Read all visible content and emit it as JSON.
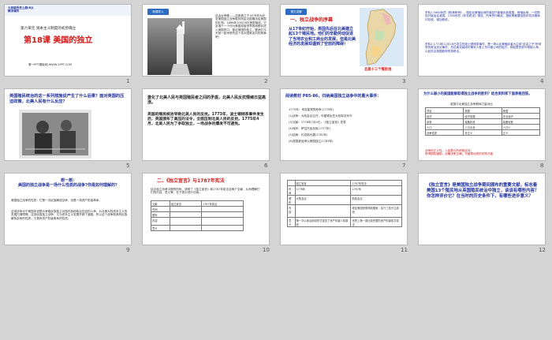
{
  "colors": {
    "accent_red": "#d21a1a",
    "title_blue": "#1f2f9c",
    "band_blue": "#2e6cc2"
  },
  "slides": [
    {
      "num": "1",
      "header": "九年级历史上册(RJ)\n教学课件",
      "unit": "第六单元 资本主义制度的初步确立",
      "title": "第18课  美国的独立",
      "footer": "第一PPT模板网-WWW.1PPT.COM"
    },
    {
      "num": "2",
      "tag": "新课导入",
      "text": "自由女神像——这座矗立于1876年为纪念美国独立战争胜利而由法国赠送给美国的礼物。1886年10月28日美国落成，它坐落于一个作为美国迎接世界各地移民进入美国的口，象征美国的独立，要我们今天就一起来研究这个伟大国家走向的故事吧！"
    },
    {
      "num": "3",
      "tag": "课文讲解",
      "heading": "一、独立战争的序幕",
      "text": "从17世纪开始，英国先后在北美建立起13个殖民地。他们的辛勤劳动促进了当地农业和工商业的发展，但是北美经济的发展却遇到了空前的障碍！",
      "map_caption": "北美十三个殖民地"
    },
    {
      "num": "4",
      "text1": "史料1  1660年的《航海条例》，规定北美殖民地的商品只能输出到英国，而殖民地，一切物品只能运往英国。1765年的《印花税法》规定，所有的印刷品，报纸等都要加贴印花并缴纳印花税，增加税收。",
      "text2": "史料2  1773年12月16日发生的波士顿倾茶事件，是一场以北美殖民者为主体\"自由之子\"所领导的政治抗议事件，抗议者化装成印第安人登上东印度公司的船只，将船里的茶叶倾倒入海，以此抗议英国政府的茶税法。"
    },
    {
      "num": "5",
      "text": "英国殖民统治的这一系列措施说产生了什么后果？面对英国的压迫政策，北美人民有什么反应？"
    },
    {
      "num": "6",
      "text1": "激化了北美人民与英国殖民者之间的矛盾，北美人民反抗情绪日益高涨。",
      "text2": "英国的殖民统治导致北美人民的反抗。1773年，波士顿倾茶事件发生后，英国颁布了高压的法令，全面压制北美人民的反抗，1775年4月，北美人民为了争取独立，一场战争的爆发不可避免。"
    },
    {
      "num": "7",
      "heading": "阅读教材 P85-86，归纳美国独立战争中的重大事件：",
      "items": [
        "1775年：来克星顿的枪声(1775年)",
        "(2)战争：大陆会议召开，华盛顿出任大陆军总司令",
        "(3)文献：1776年7月4日，《独立宣言》发表",
        "(4)转折：萨拉托加战役(1777年)",
        "(5)结局：约克镇大捷(1781年)",
        "(6)英国被迫承认美国独立(1783年)"
      ]
    },
    {
      "num": "8",
      "heading": "为什么弱小的美国能够取得独立战争的胜利？结合资料和下面表格回答。",
      "table_title": "英国与北美独立战争期间力量对比",
      "cols": [
        "项目",
        "英国",
        "美国"
      ],
      "rows": [
        [
          "经济",
          "经济发展",
          "农业经济"
        ],
        [
          "军事",
          "装备精良",
          "装备较差"
        ],
        [
          "人口",
          "人口众多",
          "人口少"
        ],
        [
          "战争性质",
          "非正义",
          "正义"
        ]
      ],
      "conclusion": "战争的正义性；人民群众的积极支持；\n获得国际援助，战略决策正确；华盛顿优秀的领导才能"
    },
    {
      "num": "9",
      "heading": "想一想：\n美国的独立战争是一场什么性质的战争?你是如何理解的？",
      "text1": "美国独立战争的性质：它是一次民族解放战争，也是一场资产阶级革命。",
      "text2": "这场战争对于美国来说是为争取民族独立对国内各种政治压迫的斗争，为北美大陆资本主义的发展扫清障碍。这场民族独立战争，又为资本主义发展开辟了道路。所以这个战争既具有民族解放战争的性质，又具有资产阶级革命的性质。"
    },
    {
      "num": "10",
      "heading": "二、《独立宣言》与1787年宪法",
      "intro": "结合独立战争中期的阶段，请带了《独立宣言》和1787年宪法这两个文献，从而理解它们的内容、意义等，在下表中进行归纳。",
      "cols": [
        "文献",
        "独立宣言",
        "1787年宪法"
      ],
      "rows": [
        "时间",
        "颁布",
        "内容",
        "意义"
      ]
    },
    {
      "num": "11",
      "cols": [
        "",
        "独立宣言",
        "1787年宪法"
      ],
      "rows": [
        [
          "时间",
          "1776年",
          "1787年"
        ],
        [
          "颁布",
          "大陆会议",
          "制宪会议"
        ],
        [
          "内容",
          "",
          "规定美国是联邦制国家，实行三权分立原则"
        ],
        [
          "意义",
          "第一次以政治纲领形式宣告了资产阶级人权原则",
          "世界上第一部比较完整的资产阶级成文宪法"
        ]
      ]
    },
    {
      "num": "12",
      "text": "《独立宣言》是美国独立战争期间颁布的重要文献，标志着美国13个殖民地从英国殖民统治中独立，谈谈有哪些内容？你怎样评价它？在当时的历史条件下，有哪些进步意义？"
    }
  ]
}
